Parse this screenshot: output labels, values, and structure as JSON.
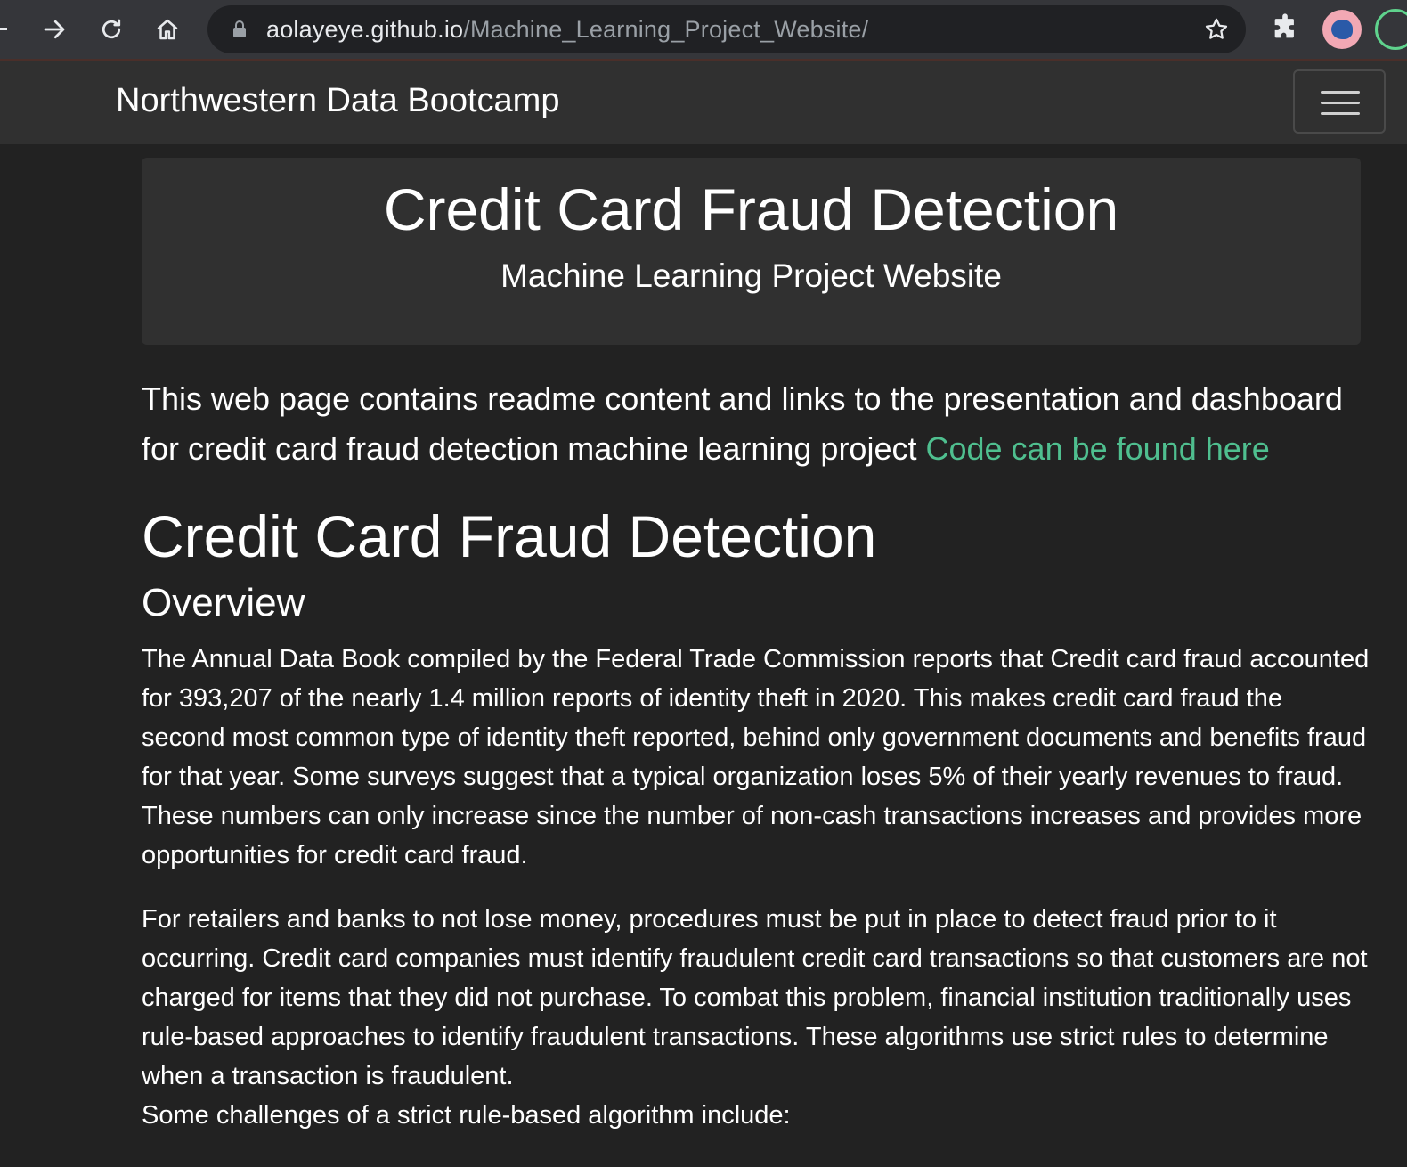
{
  "browser": {
    "url_host": "aolayeye.github.io",
    "url_path": "/Machine_Learning_Project_Website/"
  },
  "navbar": {
    "brand": "Northwestern Data Bootcamp"
  },
  "jumbotron": {
    "title": "Credit Card Fraud Detection",
    "subtitle": "Machine Learning Project Website"
  },
  "content": {
    "intro_text": "This web page contains readme content and links to the presentation and dashboard for credit card fraud detection machine learning project ",
    "intro_link": "Code can be found here",
    "heading": "Credit Card Fraud Detection",
    "subheading": "Overview",
    "paragraph1": "The Annual Data Book compiled by the Federal Trade Commission reports that Credit card fraud accounted for 393,207 of the nearly 1.4 million reports of identity theft in 2020. This makes credit card fraud the second most common type of identity theft reported, behind only government documents and benefits fraud for that year. Some surveys suggest that a typical organization loses 5% of their yearly revenues to fraud. These numbers can only increase since the number of non-cash transactions increases and provides more opportunities for credit card fraud.",
    "paragraph2": "For retailers and banks to not lose money, procedures must be put in place to detect fraud prior to it occurring. Credit card companies must identify fraudulent credit card transactions so that customers are not charged for items that they did not purchase. To combat this problem, financial institution traditionally uses rule-based approaches to identify fraudulent transactions. These algorithms use strict rules to determine when a transaction is fraudulent.",
    "paragraph3": "Some challenges of a strict rule-based algorithm include:"
  }
}
